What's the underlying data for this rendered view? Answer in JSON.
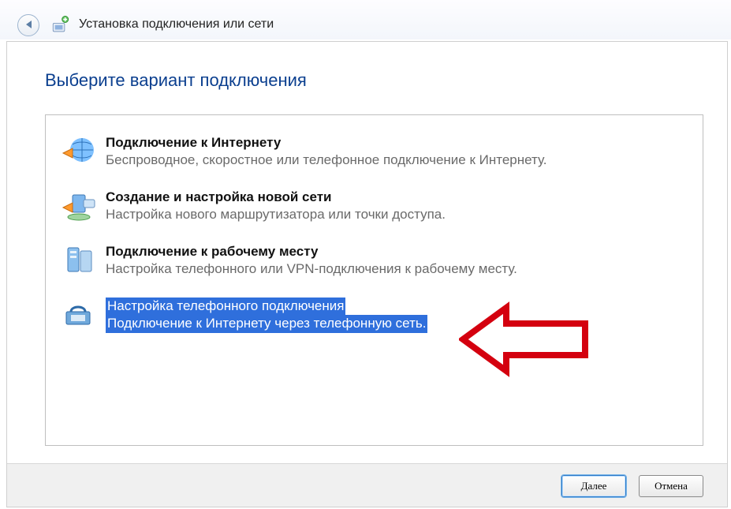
{
  "header": {
    "title": "Установка подключения или сети"
  },
  "wizard": {
    "title": "Выберите вариант подключения",
    "options": [
      {
        "title": "Подключение к Интернету",
        "desc": "Беспроводное, скоростное или телефонное подключение к Интернету."
      },
      {
        "title": "Создание и настройка новой сети",
        "desc": "Настройка нового маршрутизатора или точки доступа."
      },
      {
        "title": "Подключение к рабочему месту",
        "desc": "Настройка телефонного или VPN-подключения к рабочему месту."
      },
      {
        "title": "Настройка телефонного подключения",
        "desc": "Подключение к Интернету через телефонную сеть."
      }
    ],
    "selected_index": 3
  },
  "buttons": {
    "next": "Далее",
    "cancel": "Отмена"
  }
}
